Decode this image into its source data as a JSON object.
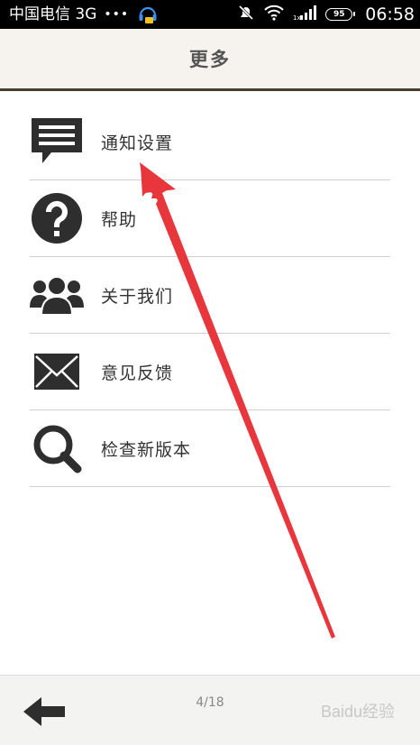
{
  "status_bar": {
    "carrier": "中国电信 3G",
    "dots": "•••",
    "battery": "95",
    "time": "06:58"
  },
  "header": {
    "title": "更多"
  },
  "menu": {
    "items": [
      {
        "label": "通知设置",
        "icon": "notification-icon"
      },
      {
        "label": "帮助",
        "icon": "help-icon"
      },
      {
        "label": "关于我们",
        "icon": "users-icon"
      },
      {
        "label": "意见反馈",
        "icon": "envelope-icon"
      },
      {
        "label": "检查新版本",
        "icon": "search-icon"
      }
    ]
  },
  "footer": {
    "pager": "4/18",
    "watermark": "Baidu经验"
  },
  "colors": {
    "header_bg": "#f6f3ee",
    "header_border": "#4a3b2c",
    "icon": "#2e2e2e",
    "annotation_arrow": "#e8363d"
  }
}
